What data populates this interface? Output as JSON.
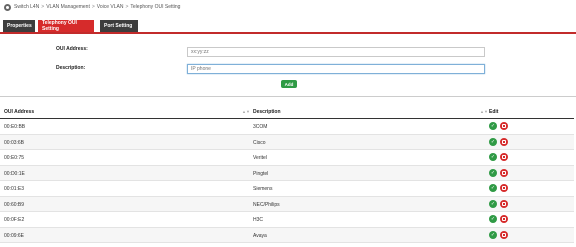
{
  "breadcrumb": [
    "Switch L4N",
    "VLAN Management",
    "Voice VLAN",
    "Telephony OUI Setting"
  ],
  "tabs": [
    {
      "label": "Properties",
      "active": false
    },
    {
      "label": "Telephony OUI Setting",
      "active": true
    },
    {
      "label": "Port Setting",
      "active": false
    }
  ],
  "form": {
    "oui_label": "OUI Address:",
    "oui_placeholder": "xx:yy:zz",
    "description_label": "Description:",
    "description_placeholder": "IP phone",
    "add_label": "Add"
  },
  "table": {
    "headers": {
      "oui": "OUI Address",
      "description": "Description",
      "edit": "Edit"
    },
    "rows": [
      {
        "oui": "00:E0:BB",
        "description": "3COM"
      },
      {
        "oui": "00:03:6B",
        "description": "Cisco"
      },
      {
        "oui": "00:E0:75",
        "description": "Veritel"
      },
      {
        "oui": "00:D0:1E",
        "description": "Pingtel"
      },
      {
        "oui": "00:01:E3",
        "description": "Siemens"
      },
      {
        "oui": "00:60:B9",
        "description": "NEC/Philips"
      },
      {
        "oui": "00:0F:E2",
        "description": "H3C"
      },
      {
        "oui": "00:09:6E",
        "description": "Avaya"
      }
    ]
  },
  "colors": {
    "accent_red": "#d62b2b",
    "tab_dark": "#3d3d3d",
    "action_green": "#2f9a45"
  }
}
